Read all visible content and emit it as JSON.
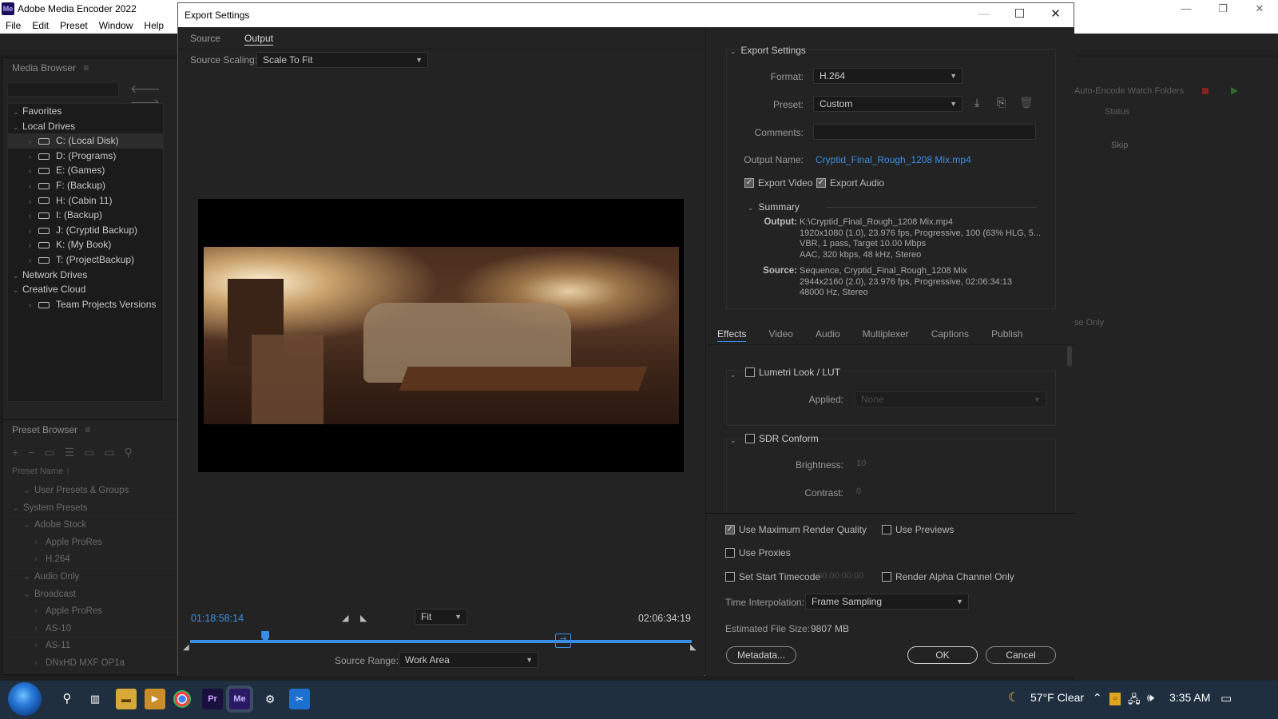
{
  "app": {
    "title": "Adobe Media Encoder 2022",
    "logo": "Me",
    "menu": [
      "File",
      "Edit",
      "Preset",
      "Window",
      "Help"
    ]
  },
  "media_browser": {
    "title": "Media Browser",
    "tree": [
      {
        "label": "Favorites",
        "level": 0,
        "icon": ""
      },
      {
        "label": "Local Drives",
        "level": 0,
        "icon": ""
      },
      {
        "label": "C: (Local Disk)",
        "level": 1,
        "icon": "drive"
      },
      {
        "label": "D: (Programs)",
        "level": 1,
        "icon": "drive"
      },
      {
        "label": "E: (Games)",
        "level": 1,
        "icon": "drive"
      },
      {
        "label": "F: (Backup)",
        "level": 1,
        "icon": "drive"
      },
      {
        "label": "H: (Cabin 11)",
        "level": 1,
        "icon": "drive"
      },
      {
        "label": "I: (Backup)",
        "level": 1,
        "icon": "drive"
      },
      {
        "label": "J: (Cryptid Backup)",
        "level": 1,
        "icon": "drive"
      },
      {
        "label": "K: (My Book)",
        "level": 1,
        "icon": "drive"
      },
      {
        "label": "T: (ProjectBackup)",
        "level": 1,
        "icon": "drive"
      },
      {
        "label": "Network Drives",
        "level": 0,
        "icon": ""
      },
      {
        "label": "Creative Cloud",
        "level": 0,
        "icon": ""
      },
      {
        "label": "Team Projects Versions",
        "level": 1,
        "icon": "drive"
      }
    ]
  },
  "preset_browser": {
    "title": "Preset Browser",
    "column": "Preset Name",
    "rows": [
      {
        "label": "User Presets & Groups",
        "level": 1
      },
      {
        "label": "System Presets",
        "level": 0
      },
      {
        "label": "Adobe Stock",
        "level": 1
      },
      {
        "label": "Apple ProRes",
        "level": 2
      },
      {
        "label": "H.264",
        "level": 2
      },
      {
        "label": "Audio Only",
        "level": 1
      },
      {
        "label": "Broadcast",
        "level": 1
      },
      {
        "label": "Apple ProRes",
        "level": 2
      },
      {
        "label": "AS-10",
        "level": 2
      },
      {
        "label": "AS-11",
        "level": 2
      },
      {
        "label": "DNxHD MXF OP1a",
        "level": 2
      }
    ]
  },
  "queue_bg": {
    "watch": "Auto-Encode Watch Folders",
    "status": "Status",
    "skip": "Skip",
    "only": "se Only"
  },
  "dialog": {
    "title": "Export Settings",
    "left_tabs": [
      "Source",
      "Output"
    ],
    "active_left_tab": "Output",
    "source_scaling_label": "Source Scaling:",
    "source_scaling_value": "Scale To Fit",
    "timecode_in": "01:18:58:14",
    "timecode_out": "02:06:34:19",
    "zoom_value": "Fit",
    "source_range_label": "Source Range:",
    "source_range_value": "Work Area",
    "playhead_fraction": 0.15
  },
  "export_settings": {
    "heading": "Export Settings",
    "format_label": "Format:",
    "format_value": "H.264",
    "preset_label": "Preset:",
    "preset_value": "Custom",
    "comments_label": "Comments:",
    "comments_value": "",
    "output_name_label": "Output Name:",
    "output_name_value": "Cryptid_Final_Rough_1208 Mix.mp4",
    "export_video_label": "Export Video",
    "export_audio_label": "Export Audio",
    "summary_heading": "Summary",
    "output_label": "Output:",
    "output_lines": [
      "K:\\Cryptid_Final_Rough_1208 Mix.mp4",
      "1920x1080 (1.0), 23.976 fps, Progressive, 100 (63% HLG, 5...",
      "VBR, 1 pass, Target 10.00 Mbps",
      "AAC, 320 kbps, 48 kHz, Stereo"
    ],
    "source_label": "Source:",
    "source_lines": [
      "Sequence, Cryptid_Final_Rough_1208 Mix",
      "2944x2160 (2.0), 23.976 fps, Progressive, 02:06:34:13",
      "48000 Hz, Stereo"
    ]
  },
  "settings_tabs": [
    "Effects",
    "Video",
    "Audio",
    "Multiplexer",
    "Captions",
    "Publish"
  ],
  "effects": {
    "lumetri_label": "Lumetri Look / LUT",
    "applied_label": "Applied:",
    "applied_value": "None",
    "sdr_label": "SDR Conform",
    "brightness_label": "Brightness:",
    "brightness_value": "10",
    "contrast_label": "Contrast:",
    "contrast_value": "0"
  },
  "render_options": {
    "max_render_quality": "Use Maximum Render Quality",
    "use_previews": "Use Previews",
    "use_proxies": "Use Proxies",
    "set_start_timecode": "Set Start Timecode",
    "start_timecode_value": "00:00:00:00",
    "render_alpha": "Render Alpha Channel Only",
    "time_interp_label": "Time Interpolation:",
    "time_interp_value": "Frame Sampling",
    "file_size_label": "Estimated File Size:",
    "file_size_value": "9807 MB",
    "metadata_button": "Metadata...",
    "ok_button": "OK",
    "cancel_button": "Cancel"
  },
  "taskbar": {
    "weather": "57°F  Clear",
    "time": "3:35 AM",
    "pr_label": "Pr",
    "me_label": "Me"
  }
}
